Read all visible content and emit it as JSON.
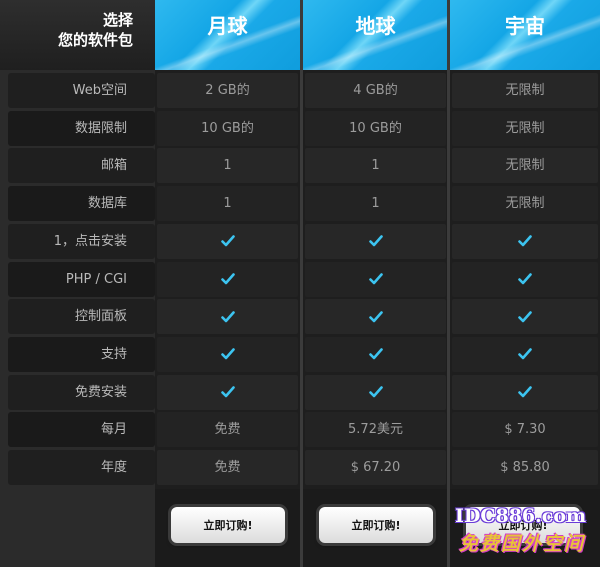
{
  "header": {
    "title_line1": "选择",
    "title_line2": "您的软件包"
  },
  "rows": [
    {
      "label": "Web空间"
    },
    {
      "label": "数据限制"
    },
    {
      "label": "邮箱"
    },
    {
      "label": "数据库"
    },
    {
      "label": "1，点击安装"
    },
    {
      "label": "PHP / CGI"
    },
    {
      "label": "控制面板"
    },
    {
      "label": "支持"
    },
    {
      "label": "免费安装"
    },
    {
      "label": "每月"
    },
    {
      "label": "年度"
    }
  ],
  "plans": [
    {
      "name": "月球",
      "cells": [
        "2 GB的",
        "10 GB的",
        "1",
        "1",
        "✔",
        "✔",
        "✔",
        "✔",
        "✔",
        "免费",
        "免费"
      ],
      "order_label": "立即订购!"
    },
    {
      "name": "地球",
      "cells": [
        "4 GB的",
        "10 GB的",
        "1",
        "1",
        "✔",
        "✔",
        "✔",
        "✔",
        "✔",
        "5.72美元",
        "$ 67.20"
      ],
      "order_label": "立即订购!"
    },
    {
      "name": "宇宙",
      "cells": [
        "无限制",
        "无限制",
        "无限制",
        "无限制",
        "✔",
        "✔",
        "✔",
        "✔",
        "✔",
        "$ 7.30",
        "$ 85.80"
      ],
      "order_label": "立即订购!"
    }
  ],
  "watermark": {
    "line1": "IDC886.com",
    "line2": "免费国外空间"
  },
  "colors": {
    "header_blue": "#1aa9e8",
    "check": "#3cc4f0",
    "background": "#222222"
  },
  "icons": {
    "check": "check-icon"
  }
}
